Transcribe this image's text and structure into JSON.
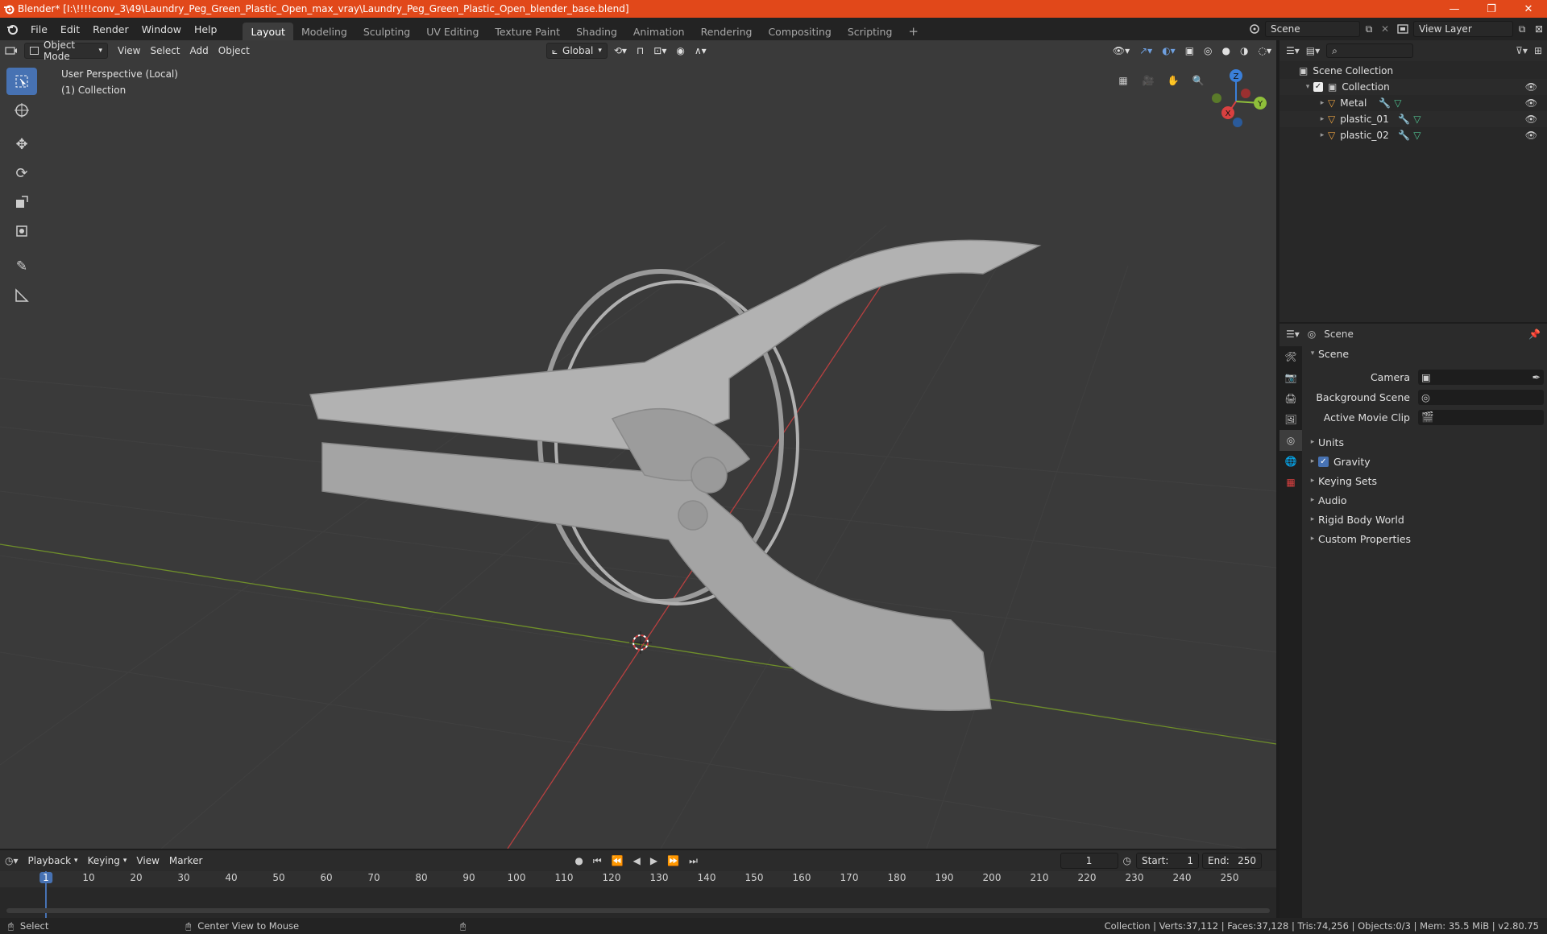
{
  "window": {
    "title": "Blender* [I:\\!!!!conv_3\\49\\Laundry_Peg_Green_Plastic_Open_max_vray\\Laundry_Peg_Green_Plastic_Open_blender_base.blend]",
    "minimize": "—",
    "restore": "❐",
    "close": "✕"
  },
  "menu": [
    "File",
    "Edit",
    "Render",
    "Window",
    "Help"
  ],
  "workspaces": [
    {
      "label": "Layout",
      "active": true
    },
    {
      "label": "Modeling",
      "active": false
    },
    {
      "label": "Sculpting",
      "active": false
    },
    {
      "label": "UV Editing",
      "active": false
    },
    {
      "label": "Texture Paint",
      "active": false
    },
    {
      "label": "Shading",
      "active": false
    },
    {
      "label": "Animation",
      "active": false
    },
    {
      "label": "Rendering",
      "active": false
    },
    {
      "label": "Compositing",
      "active": false
    },
    {
      "label": "Scripting",
      "active": false
    }
  ],
  "scene_selector": {
    "value": "Scene"
  },
  "view_layer_selector": {
    "value": "View Layer"
  },
  "viewport": {
    "mode": "Object Mode",
    "menus": [
      "View",
      "Select",
      "Add",
      "Object"
    ],
    "orientation": "Global",
    "info_line1": "User Perspective (Local)",
    "info_line2": "(1) Collection",
    "gizmo": {
      "x": "X",
      "y": "Y",
      "z": "Z"
    }
  },
  "outliner": {
    "root": "Scene Collection",
    "collection": "Collection",
    "objects": [
      "Metal",
      "plastic_01",
      "plastic_02"
    ]
  },
  "properties": {
    "context": "Scene",
    "panel": "Scene",
    "fields": [
      {
        "label": "Camera",
        "value": ""
      },
      {
        "label": "Background Scene",
        "value": ""
      },
      {
        "label": "Active Movie Clip",
        "value": ""
      }
    ],
    "subpanels": [
      "Units",
      "Gravity",
      "Keying Sets",
      "Audio",
      "Rigid Body World",
      "Custom Properties"
    ],
    "gravity_checked": true
  },
  "timeline": {
    "menus": [
      "Playback",
      "Keying",
      "View",
      "Marker"
    ],
    "current_frame": "1",
    "start_label": "Start:",
    "start": "1",
    "end_label": "End:",
    "end": "250",
    "ticks": [
      "1",
      "10",
      "20",
      "30",
      "40",
      "50",
      "60",
      "70",
      "80",
      "90",
      "100",
      "110",
      "120",
      "130",
      "140",
      "150",
      "160",
      "170",
      "180",
      "190",
      "200",
      "210",
      "220",
      "230",
      "240",
      "250"
    ]
  },
  "statusbar": {
    "left": "Select",
    "middle": "Center View to Mouse",
    "right": "Collection | Verts:37,112 | Faces:37,128 | Tris:74,256 | Objects:0/3 | Mem: 35.5 MiB | v2.80.75"
  },
  "colors": {
    "titlebar": "#e1481a",
    "accent": "#4772b3",
    "x_axis": "#d94040",
    "y_axis": "#8fbf3a",
    "z_axis": "#3a7fd9",
    "object_orange": "#e8a040"
  }
}
